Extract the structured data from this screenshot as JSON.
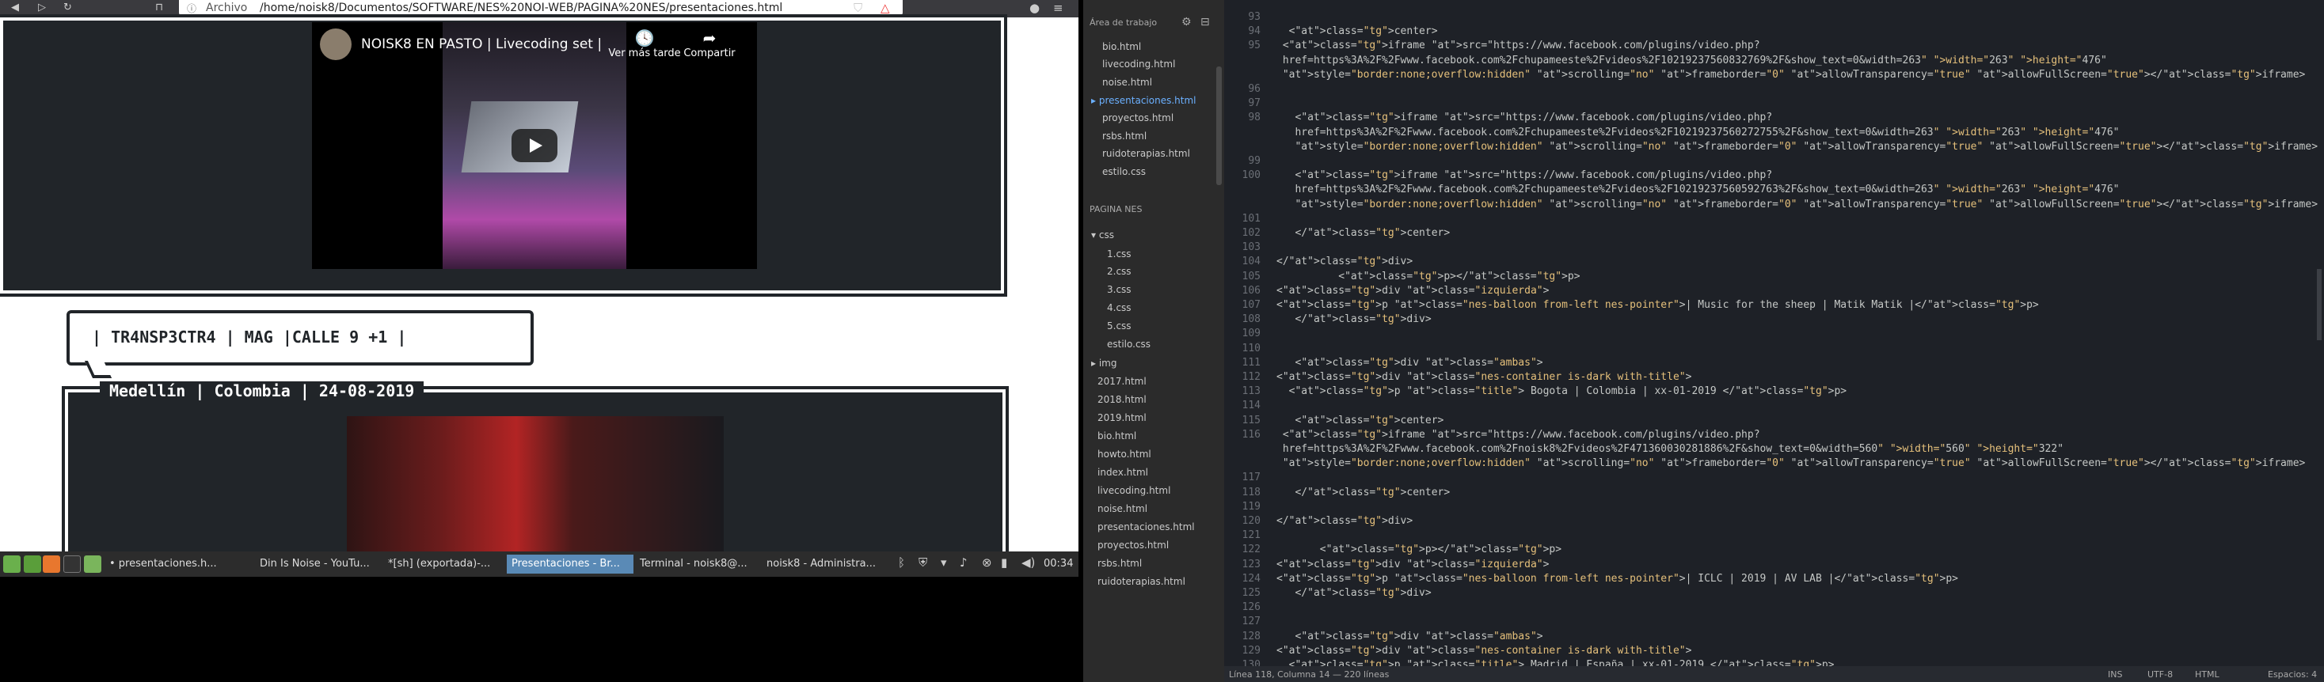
{
  "browser": {
    "back_icon": "back-arrow",
    "forward_icon": "forward-arrow",
    "reload_icon": "reload",
    "bookmark_icon": "bookmark",
    "url_prefix": "Archivo",
    "url": "/home/noisk8/Documentos/SOFTWARE/NES%20NOI-WEB/PAGINA%20NES/presentaciones.html"
  },
  "page": {
    "video1": {
      "title": "NOISK8 EN PASTO | Livecoding set |",
      "watch_later": "Ver más tarde",
      "share": "Compartir"
    },
    "balloon_text": "| TR4NSP3CTR4 | MAG |CALLE 9 +1 |",
    "container2_title": "Medellín | Colombia | 24-08-2019"
  },
  "taskbar": {
    "tasks": [
      "• presentaciones.h...",
      "Din Is Noise - YouTu...",
      "*[sh] (exportada)-...",
      "Presentaciones - Br...",
      "Terminal - noisk8@...",
      "noisk8 - Administra..."
    ],
    "active_task": "Presentaciones - Br...",
    "clock": "00:34"
  },
  "sidebar": {
    "workspace_label": "Área de trabajo",
    "open_files": [
      "bio.html",
      "livecoding.html",
      "noise.html",
      "presentaciones.html",
      "proyectos.html",
      "rsbs.html",
      "ruidoterapias.html",
      "estilo.css"
    ],
    "project_label": "PAGINA NES",
    "css_folder": "css",
    "css_files": [
      "1.css",
      "2.css",
      "3.css",
      "4.css",
      "5.css",
      "estilo.css"
    ],
    "img_folder": "img",
    "root_files": [
      "2017.html",
      "2018.html",
      "2019.html",
      "bio.html",
      "howto.html",
      "index.html",
      "livecoding.html",
      "noise.html",
      "presentaciones.html",
      "proyectos.html",
      "rsbs.html",
      "ruidoterapias.html"
    ]
  },
  "editor": {
    "lines": [
      {
        "n": "93",
        "code": ""
      },
      {
        "n": "94",
        "code": "  <center>"
      },
      {
        "n": "95",
        "code": " <iframe src=\"https://www.facebook.com/plugins/video.php?"
      },
      {
        "n": "",
        "code": " href=https%3A%2F%2Fwww.facebook.com%2Fchupameeste%2Fvideos%2F10219237560832769%2F&show_text=0&width=263\" width=\"263\" height=\"476\""
      },
      {
        "n": "",
        "code": " style=\"border:none;overflow:hidden\" scrolling=\"no\" frameborder=\"0\" allowTransparency=\"true\" allowFullScreen=\"true\"></iframe>"
      },
      {
        "n": "96",
        "code": ""
      },
      {
        "n": "97",
        "code": ""
      },
      {
        "n": "98",
        "code": "   <iframe src=\"https://www.facebook.com/plugins/video.php?"
      },
      {
        "n": "",
        "code": "   href=https%3A%2F%2Fwww.facebook.com%2Fchupameeste%2Fvideos%2F10219237560272755%2F&show_text=0&width=263\" width=\"263\" height=\"476\""
      },
      {
        "n": "",
        "code": "   style=\"border:none;overflow:hidden\" scrolling=\"no\" frameborder=\"0\" allowTransparency=\"true\" allowFullScreen=\"true\"></iframe>"
      },
      {
        "n": "99",
        "code": ""
      },
      {
        "n": "100",
        "code": "   <iframe src=\"https://www.facebook.com/plugins/video.php?"
      },
      {
        "n": "",
        "code": "   href=https%3A%2F%2Fwww.facebook.com%2Fchupameeste%2Fvideos%2F10219237560592763%2F&show_text=0&width=263\" width=\"263\" height=\"476\""
      },
      {
        "n": "",
        "code": "   style=\"border:none;overflow:hidden\" scrolling=\"no\" frameborder=\"0\" allowTransparency=\"true\" allowFullScreen=\"true\"></iframe>"
      },
      {
        "n": "101",
        "code": ""
      },
      {
        "n": "102",
        "code": "   </center>"
      },
      {
        "n": "103",
        "code": ""
      },
      {
        "n": "104",
        "code": "</div>"
      },
      {
        "n": "105",
        "code": "          <p></p>"
      },
      {
        "n": "106",
        "code": "<div class=\"izquierda\">"
      },
      {
        "n": "107",
        "code": "<p class=\"nes-balloon from-left nes-pointer\">| Music for the sheep | Matik Matik |</p>"
      },
      {
        "n": "108",
        "code": "   </div>"
      },
      {
        "n": "109",
        "code": ""
      },
      {
        "n": "110",
        "code": ""
      },
      {
        "n": "111",
        "code": "   <div class=\"ambas\">"
      },
      {
        "n": "112",
        "code": "<div class=\"nes-container is-dark with-title\">"
      },
      {
        "n": "113",
        "code": "  <p class=\"title\"> Bogota | Colombia | xx-01-2019 </p>"
      },
      {
        "n": "114",
        "code": ""
      },
      {
        "n": "115",
        "code": "   <center>"
      },
      {
        "n": "116",
        "code": " <iframe src=\"https://www.facebook.com/plugins/video.php?"
      },
      {
        "n": "",
        "code": " href=https%3A%2F%2Fwww.facebook.com%2Fnoisk8%2Fvideos%2F471360030281886%2F&show_text=0&width=560\" width=\"560\" height=\"322\""
      },
      {
        "n": "",
        "code": " style=\"border:none;overflow:hidden\" scrolling=\"no\" frameborder=\"0\" allowTransparency=\"true\" allowFullScreen=\"true\"></iframe>"
      },
      {
        "n": "117",
        "code": ""
      },
      {
        "n": "118",
        "code": "   </center>"
      },
      {
        "n": "119",
        "code": ""
      },
      {
        "n": "120",
        "code": "</div>"
      },
      {
        "n": "121",
        "code": ""
      },
      {
        "n": "122",
        "code": "       <p></p>"
      },
      {
        "n": "123",
        "code": "<div class=\"izquierda\">"
      },
      {
        "n": "124",
        "code": "<p class=\"nes-balloon from-left nes-pointer\">| ICLC | 2019 | AV LAB |</p>"
      },
      {
        "n": "125",
        "code": "   </div>"
      },
      {
        "n": "126",
        "code": ""
      },
      {
        "n": "127",
        "code": ""
      },
      {
        "n": "128",
        "code": "   <div class=\"ambas\">"
      },
      {
        "n": "129",
        "code": "<div class=\"nes-container is-dark with-title\">"
      },
      {
        "n": "130",
        "code": "  <p class=\"title\"> Madrid | España | xx-01-2019 </p>"
      }
    ],
    "status_left": "Línea 118, Columna 14 — 220 líneas",
    "status_ins": "INS",
    "status_encoding": "UTF-8",
    "status_syntax": "HTML",
    "status_spaces": "Espacios: 4"
  }
}
